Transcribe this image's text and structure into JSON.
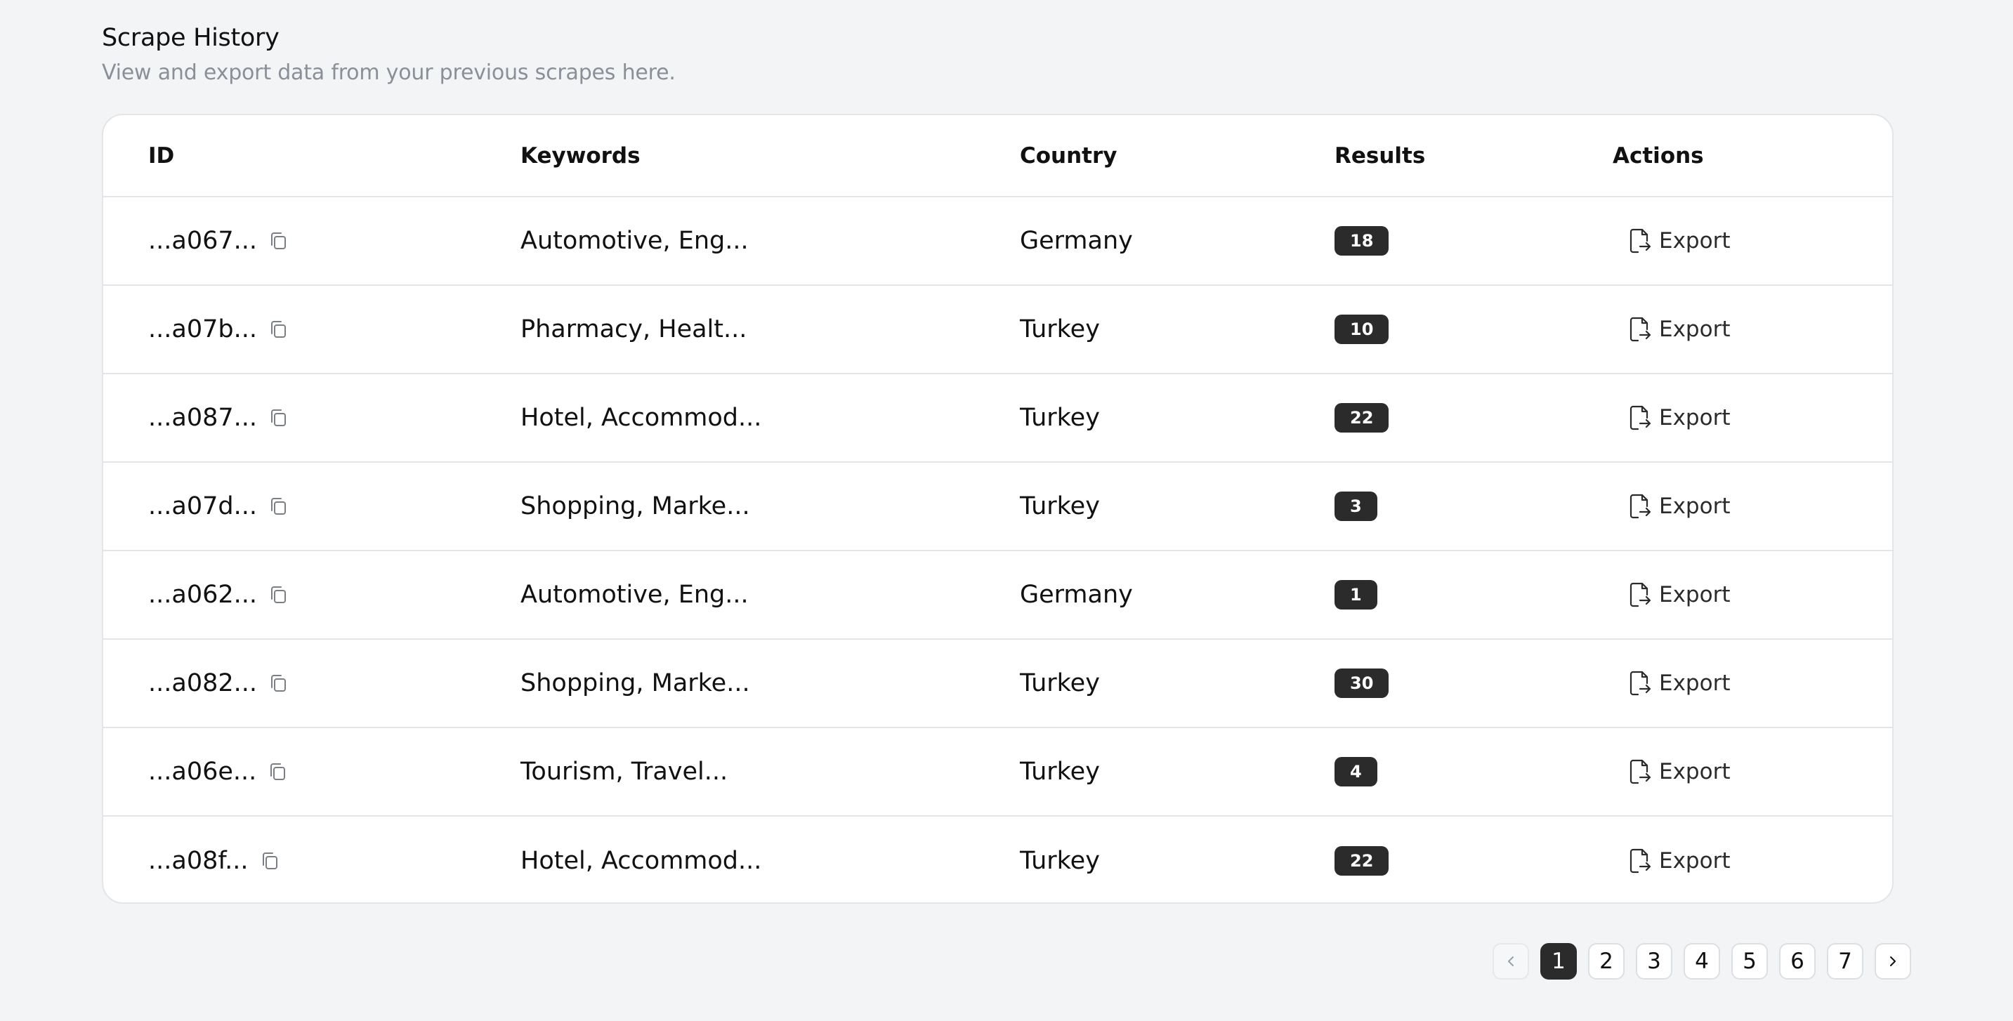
{
  "header": {
    "title": "Scrape History",
    "subtitle": "View and export data from your previous scrapes here."
  },
  "table": {
    "columns": {
      "id": "ID",
      "keywords": "Keywords",
      "country": "Country",
      "results": "Results",
      "actions": "Actions"
    },
    "export_label": "Export",
    "rows": [
      {
        "id": "...a067...",
        "keywords": "Automotive, Eng...",
        "country": "Germany",
        "results": "18"
      },
      {
        "id": "...a07b...",
        "keywords": "Pharmacy, Healt...",
        "country": "Turkey",
        "results": "10"
      },
      {
        "id": "...a087...",
        "keywords": "Hotel, Accommod...",
        "country": "Turkey",
        "results": "22"
      },
      {
        "id": "...a07d...",
        "keywords": "Shopping, Marke...",
        "country": "Turkey",
        "results": "3"
      },
      {
        "id": "...a062...",
        "keywords": "Automotive, Eng...",
        "country": "Germany",
        "results": "1"
      },
      {
        "id": "...a082...",
        "keywords": "Shopping, Marke...",
        "country": "Turkey",
        "results": "30"
      },
      {
        "id": "...a06e...",
        "keywords": "Tourism, Travel...",
        "country": "Turkey",
        "results": "4"
      },
      {
        "id": "...a08f...",
        "keywords": "Hotel, Accommod...",
        "country": "Turkey",
        "results": "22"
      }
    ]
  },
  "pagination": {
    "pages": [
      "1",
      "2",
      "3",
      "4",
      "5",
      "6",
      "7"
    ],
    "current": "1",
    "prev_icon": "chevron-left-icon",
    "next_icon": "chevron-right-icon"
  },
  "icons": {
    "copy": "copy-icon",
    "export": "file-export-icon"
  },
  "colors": {
    "background": "#f3f4f6",
    "badge": "#2b2b2b",
    "muted_text": "#8a8f98",
    "border": "#e3e5e8"
  }
}
